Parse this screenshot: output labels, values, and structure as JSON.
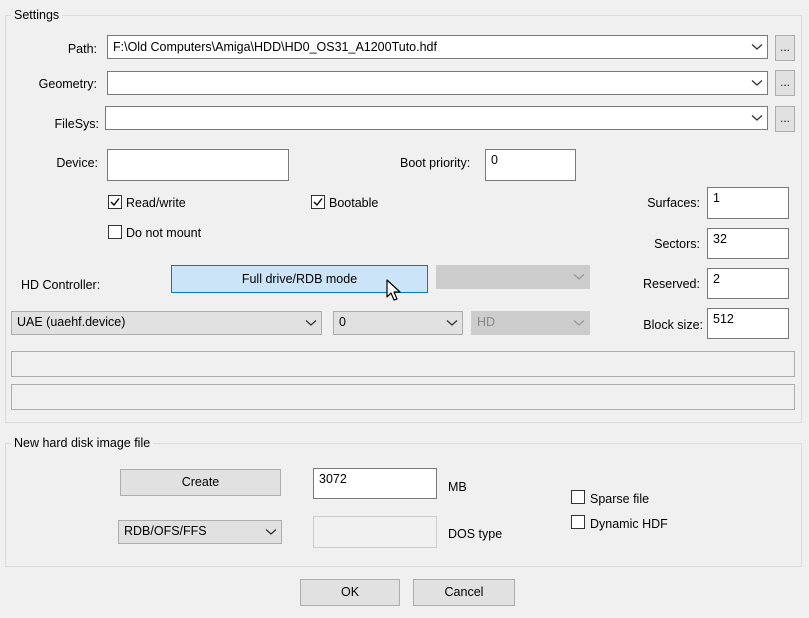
{
  "settings": {
    "title": "Settings",
    "path": {
      "label": "Path:",
      "value": "F:\\Old Computers\\Amiga\\HDD\\HD0_OS31_A1200Tuto.hdf"
    },
    "geometry": {
      "label": "Geometry:",
      "value": ""
    },
    "filesys": {
      "label": "FileSys:",
      "value": ""
    },
    "browse_label": "...",
    "device": {
      "label": "Device:",
      "value": ""
    },
    "boot_priority": {
      "label": "Boot priority:",
      "value": "0"
    },
    "read_write": {
      "label": "Read/write",
      "checked": true
    },
    "bootable": {
      "label": "Bootable",
      "checked": true
    },
    "do_not_mount": {
      "label": "Do not mount",
      "checked": false
    },
    "surfaces": {
      "label": "Surfaces:",
      "value": "1"
    },
    "sectors": {
      "label": "Sectors:",
      "value": "32"
    },
    "reserved": {
      "label": "Reserved:",
      "value": "2"
    },
    "block_size": {
      "label": "Block size:",
      "value": "512"
    },
    "hd_controller": {
      "label": "HD Controller:"
    },
    "rdb_button_label": "Full drive/RDB mode",
    "controller_select": "UAE (uaehf.device)",
    "unit_select": "0",
    "type_select": "HD"
  },
  "new_image": {
    "title": "New hard disk image file",
    "create_label": "Create",
    "size_value": "3072",
    "size_unit": "MB",
    "fs_select": "RDB/OFS/FFS",
    "dostype_label": "DOS type",
    "dostype_value": "",
    "sparse": {
      "label": "Sparse file",
      "checked": false
    },
    "dynamic": {
      "label": "Dynamic HDF",
      "checked": false
    }
  },
  "buttons": {
    "ok": "OK",
    "cancel": "Cancel"
  },
  "icons": {
    "dropdown": "chevron-down-icon",
    "checkbox": "checkmark-icon",
    "cursor": "mouse-pointer-icon"
  }
}
